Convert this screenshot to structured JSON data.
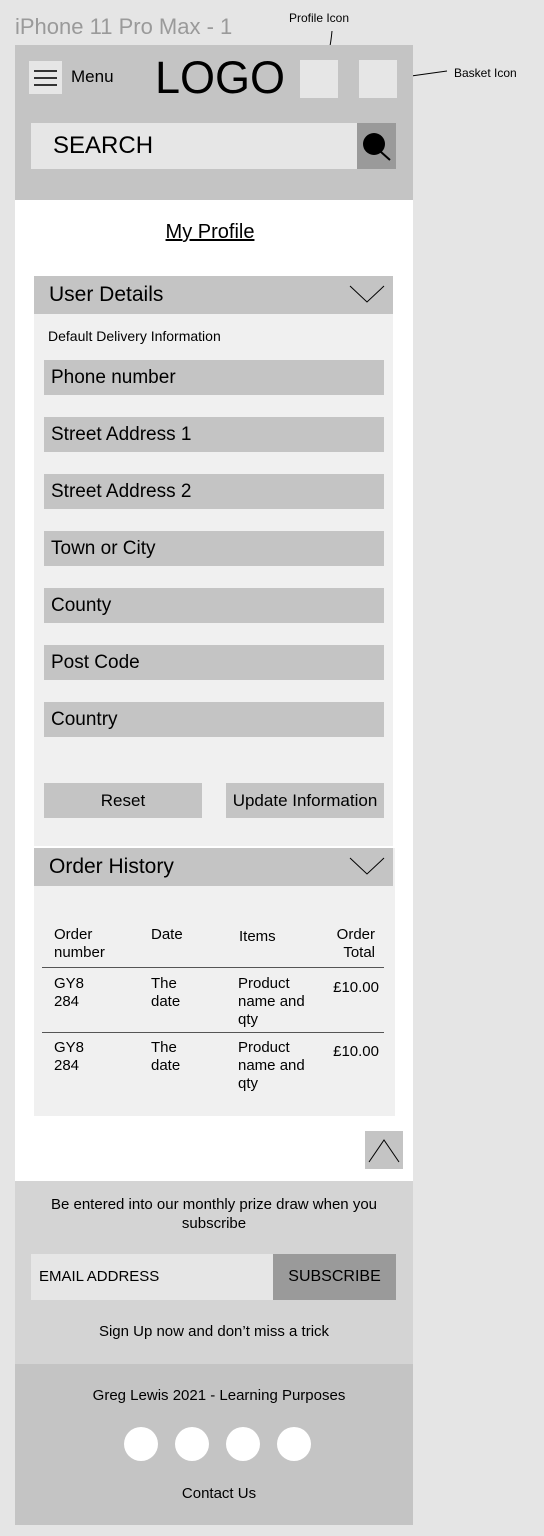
{
  "frame_label": "iPhone 11 Pro Max - 1",
  "annotations": {
    "profile": "Profile Icon",
    "basket": "Basket Icon"
  },
  "header": {
    "menu_label": "Menu",
    "logo": "LOGO",
    "search_placeholder": "SEARCH"
  },
  "page_title": "My Profile",
  "user_details": {
    "title": "User Details",
    "subtitle": "Default Delivery Information",
    "fields": [
      "Phone number",
      "Street Address 1",
      "Street Address 2",
      "Town or City",
      "County",
      "Post Code",
      "Country"
    ],
    "reset_label": "Reset",
    "update_label": "Update Information"
  },
  "order_history": {
    "title": "Order History",
    "headers": [
      "Order number",
      "Date",
      "Items",
      "Order Total"
    ],
    "rows": [
      [
        "GY8 284",
        "The date",
        "Product name and qty",
        "£10.00"
      ],
      [
        "GY8 284",
        "The date",
        "Product name and qty",
        "£10.00"
      ]
    ]
  },
  "newsletter": {
    "prize_text": "Be entered into our monthly prize draw when you subscribe",
    "email_placeholder": "EMAIL ADDRESS",
    "subscribe_label": "SUBSCRIBE",
    "signup_text": "Sign Up now and don’t miss a trick"
  },
  "footer": {
    "credit": "Greg Lewis 2021 - Learning Purposes",
    "contact": "Contact Us",
    "social_icons": [
      "social-icon-1",
      "social-icon-2",
      "social-icon-3",
      "social-icon-4"
    ]
  }
}
